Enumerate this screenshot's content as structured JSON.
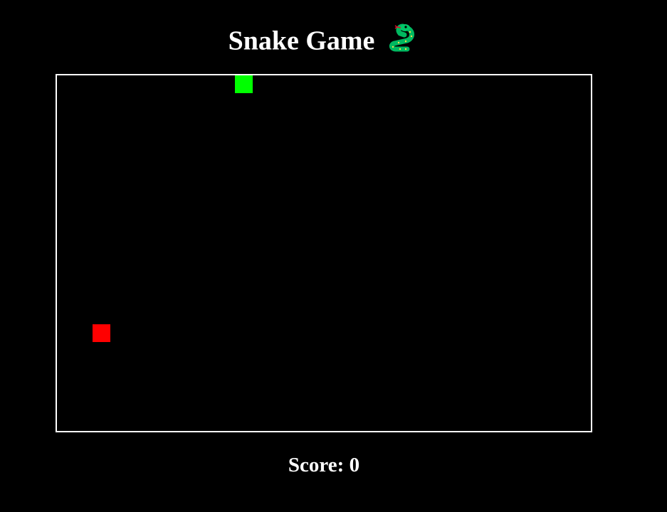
{
  "title": {
    "text": "Snake Game",
    "icon": "snake-icon"
  },
  "board": {
    "border_color": "#ffffff",
    "background": "#000000",
    "snake": {
      "color": "#00ff00",
      "segments": [
        {
          "col": 10,
          "row": 0
        }
      ]
    },
    "food": {
      "color": "#ff0000",
      "col": 2,
      "row": 14
    }
  },
  "score": {
    "label": "Score: ",
    "value": "0"
  }
}
